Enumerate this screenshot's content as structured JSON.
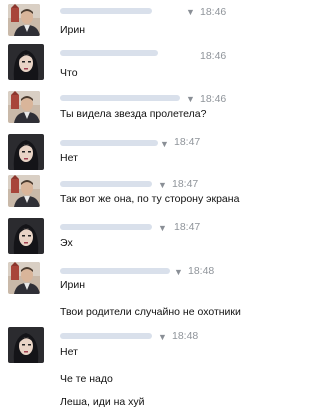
{
  "avatar_icons": {
    "male": "man-portrait-red-building-avatar",
    "female": "woman-dark-hair-portrait-avatar"
  },
  "messages": [
    {
      "sender": "male",
      "time": "18:46",
      "lines": [
        "Ирин"
      ]
    },
    {
      "sender": "female",
      "time": "18:46",
      "lines": [
        "Что"
      ]
    },
    {
      "sender": "male",
      "time": "18:46",
      "lines": [
        "Ты видела звезда пролетела?"
      ]
    },
    {
      "sender": "female",
      "time": "18:47",
      "lines": [
        "Нет"
      ]
    },
    {
      "sender": "male",
      "time": "18:47",
      "lines": [
        "Так вот же она, по ту сторону экрана"
      ]
    },
    {
      "sender": "female",
      "time": "18:47",
      "lines": [
        "Эх"
      ]
    },
    {
      "sender": "male",
      "time": "18:48",
      "lines": [
        "Ирин",
        "Твои родители случайно не охотники"
      ]
    },
    {
      "sender": "female",
      "time": "18:48",
      "lines": [
        "Нет",
        "Че те надо",
        "Леша, иди на хуй"
      ]
    }
  ]
}
